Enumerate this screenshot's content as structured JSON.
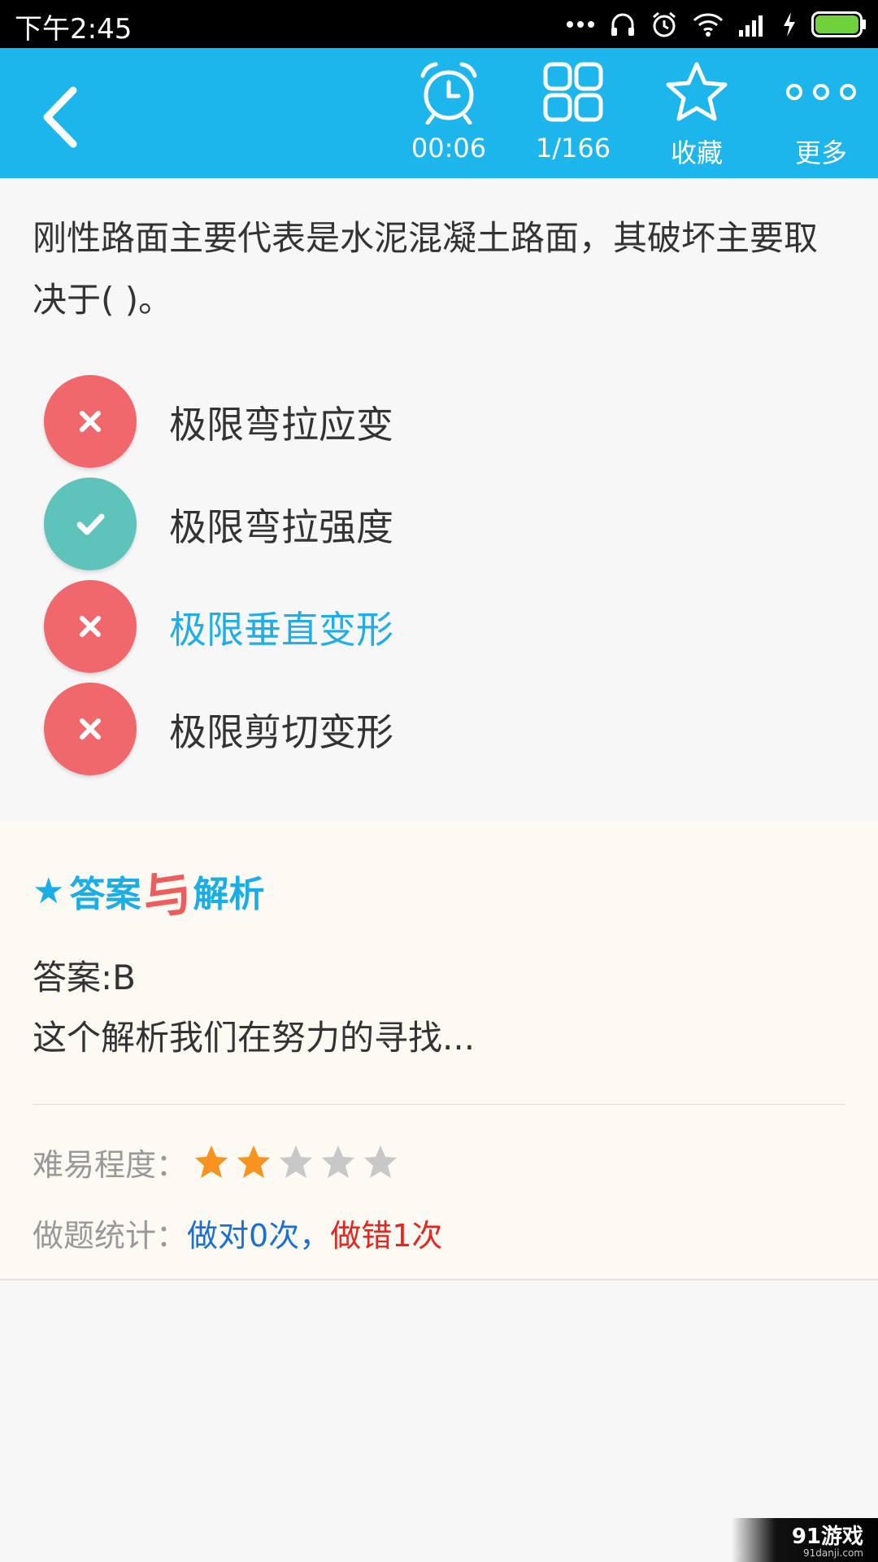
{
  "status_bar": {
    "time": "下午2:45",
    "icons": [
      "more-dots-icon",
      "headset-icon",
      "alarm-icon",
      "wifi-icon",
      "signal-icon",
      "charging-icon",
      "battery-icon"
    ]
  },
  "toolbar": {
    "back_icon": "back-arrow-icon",
    "timer": "00:06",
    "progress": "1/166",
    "favorite": "收藏",
    "more": "更多",
    "accent_color": "#1cb5ec"
  },
  "question": {
    "text": "刚性路面主要代表是水泥混凝土路面，其破坏主要取决于(   )。"
  },
  "options": [
    {
      "text": "极限弯拉应变",
      "status": "wrong",
      "icon": "cross-icon"
    },
    {
      "text": "极限弯拉强度",
      "status": "correct",
      "icon": "check-icon"
    },
    {
      "text": "极限垂直变形",
      "status": "wrong",
      "icon": "cross-icon",
      "selected": true
    },
    {
      "text": "极限剪切变形",
      "status": "wrong",
      "icon": "cross-icon"
    }
  ],
  "analysis": {
    "title_part1": "答案",
    "title_mid": "与",
    "title_part2": "解析",
    "answer": "答案:B",
    "explanation": "这个解析我们在努力的寻找...",
    "difficulty_label": "难易程度：",
    "difficulty_rating": 2,
    "difficulty_max": 5,
    "stats_label": "做题统计：",
    "stats_correct": "做对0次",
    "stats_sep": "，",
    "stats_wrong": "做错1次"
  },
  "watermark": {
    "brand": "91游戏",
    "site": "91danji.com"
  },
  "colors": {
    "wrong": "#f0686b",
    "correct": "#5ec3bb",
    "highlight": "#21aee6",
    "star_on": "#f7931e",
    "star_off": "#c8c8c8"
  }
}
